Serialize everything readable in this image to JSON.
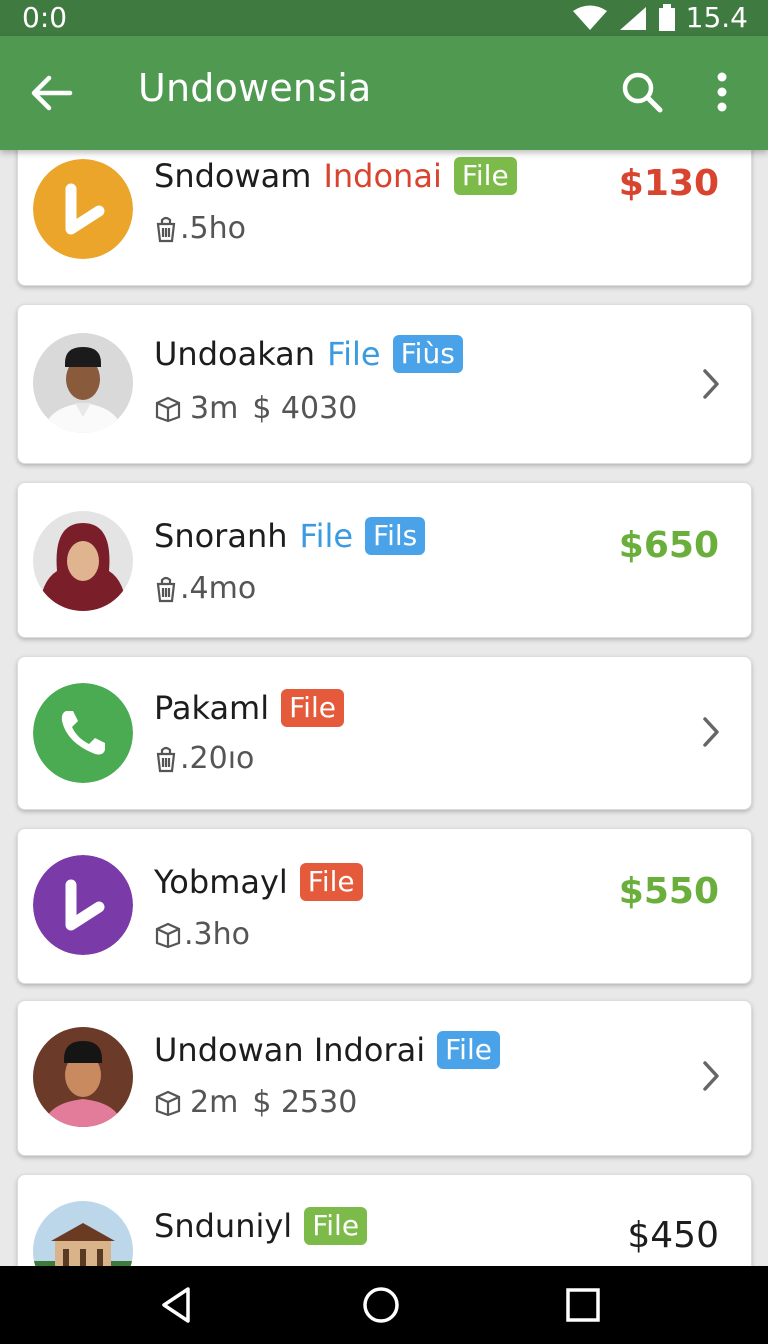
{
  "status_bar": {
    "time": "0:0",
    "battery_text": "15.4"
  },
  "app_bar": {
    "title": "Undowensia"
  },
  "icons": {
    "back": "arrow-left-icon",
    "search": "search-icon",
    "more": "more-vert-icon",
    "chevron": "chevron-right-icon",
    "bag": "bag-icon"
  },
  "colors": {
    "primary": "#4f9a50",
    "status": "#3f7a40",
    "badge_green": "#7cbb4a",
    "badge_blue": "#4aa3e8",
    "badge_red": "#e45a3a",
    "price_red": "#d9442f",
    "price_green": "#6aaf3c",
    "price_dark": "#1d1d1d"
  },
  "items": [
    {
      "name": "Sndowam",
      "accent": "Indonai",
      "badge": "File",
      "meta": ".5ho",
      "price": "$130"
    },
    {
      "name": "Undoakan",
      "accent": "File",
      "badge": "Fiùs",
      "meta": "3m",
      "meta_price": "$ 4030"
    },
    {
      "name": "Snoranh",
      "accent": "File",
      "badge": "Fils",
      "meta": ".4mo",
      "price": "$650"
    },
    {
      "name": "Pakaml",
      "badge": "File",
      "meta": ".20ıo"
    },
    {
      "name": "Yobmayl",
      "badge": "File",
      "meta": ".3ho",
      "price": "$550"
    },
    {
      "name": "Undowan Indorai",
      "badge": "File",
      "meta": "2m",
      "meta_price": "$ 2530"
    },
    {
      "name": "Snduniyl",
      "badge": "File",
      "price": "$450"
    }
  ]
}
